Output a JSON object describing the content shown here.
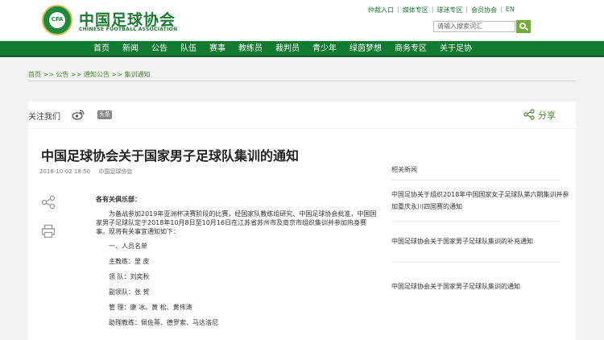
{
  "header": {
    "logo_cn": "中国足球协会",
    "logo_en": "CHINESE FOOTBALL ASSOCIATION",
    "emblem_text": "CFA",
    "top_links": [
      "仲裁入口",
      "媒体专区",
      "球迷专区",
      "会员协会"
    ],
    "lang": "EN",
    "search_placeholder": "请输入搜索词汇"
  },
  "nav": {
    "items": [
      "首页",
      "新闻",
      "公告",
      "队伍",
      "赛事",
      "教练员",
      "裁判员",
      "青少年",
      "绿茵梦想",
      "商务专区",
      "关于足协"
    ]
  },
  "breadcrumb": {
    "items": [
      "首页",
      "公告",
      "通知公告",
      "集训通知"
    ],
    "separator": ">>"
  },
  "sharebar": {
    "follow_label": "关注我们",
    "toutiao": "头条",
    "share_label": "分享"
  },
  "article": {
    "title": "中国足球协会关于国家男子足球队集训的通知",
    "date": "2018-10-02 18:50",
    "source": "中国足球协会",
    "salutation": "各有关俱乐部：",
    "paragraph": "为备战参加2019年亚洲杯决赛阶段的比赛，经国家队教练组研究、中国足球协会批准，中国国家男子足球队定于2018年10月8日至10月16日在江苏省苏州市及南京市组织集训并参加热身赛事。现将有关事宜通知如下：",
    "lines": [
      "一、人员名单",
      "主教练：里 皮",
      "领 队：刘奕秋",
      "副领队：张 贺",
      "管 理：康 冰、黄 松、黄伟涛",
      "助理教练：佩佐蒂、德罗索、马达洛尼"
    ]
  },
  "related": {
    "title": "相关新闻",
    "items": [
      "中国足协关于组织2018年中国国家女子足球队第六期集训并参加重庆永川四国赛的通知",
      "中国足球协会关于国家男子足球队集训的补充通知",
      "中国足球协会关于国家男子足球队集训的通知"
    ]
  },
  "colors": {
    "brand_green": "#0f7a30",
    "link_green": "#4a8a2e",
    "search_button": "#6fae35"
  }
}
